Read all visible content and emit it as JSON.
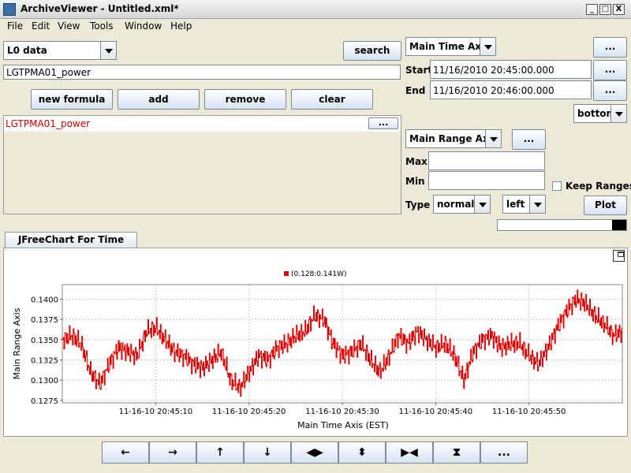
{
  "window": {
    "title": "ArchiveViewer - Untitled.xml*",
    "controls": [
      "_",
      "□",
      "X"
    ]
  },
  "menu": [
    "File",
    "Edit",
    "View",
    "Tools",
    "Window",
    "Help"
  ],
  "left": {
    "source_combo": "L0 data",
    "search_label": "search",
    "pv_input": "LGTPMA01_power",
    "buttons": {
      "new_formula": "new formula",
      "add": "add",
      "remove": "remove",
      "clear": "clear"
    },
    "list_item": "LGTPMA01_power",
    "list_item_button": "...",
    "list_item_color": "#cc0000"
  },
  "right": {
    "time_axis_combo": "Main Time Axis",
    "time_axis_button": "...",
    "start_label": "Start",
    "start_value": "11/16/2010 20:45:00.000",
    "end_label": "End",
    "end_value": "11/16/2010 20:46:00.000",
    "start_button": "...",
    "end_button": "...",
    "position_combo": "bottom",
    "range_axis_combo": "Main Range Axis",
    "range_axis_button": "...",
    "max_label": "Max",
    "max_value": "",
    "min_label": "Min",
    "min_value": "",
    "keep_ranges_label": "Keep Ranges",
    "type_label": "Type",
    "type_combo": "normal",
    "side_combo": "left",
    "plot_button": "Plot"
  },
  "tab_label": "JFreeChart For Time Plots",
  "nav_buttons": [
    "←",
    "→",
    "↑",
    "↓",
    "◀▶",
    "⬍",
    "▶◀",
    "⧗",
    "..."
  ],
  "chart_data": {
    "type": "line",
    "legend": "(0.128:0.141W)",
    "legend_placement": "top-center",
    "xlabel": "Main Time Axis (EST)",
    "ylabel": "Main Range Axis",
    "x_ticks": [
      "11-16-10 20:45:10",
      "11-16-10 20:45:20",
      "11-16-10 20:45:30",
      "11-16-10 20:45:40",
      "11-16-10 20:45:50"
    ],
    "x_tick_seconds": [
      10,
      20,
      30,
      40,
      50
    ],
    "xlim": [
      0,
      60
    ],
    "y_ticks": [
      "0.1275",
      "0.1300",
      "0.1325",
      "0.1350",
      "0.1375",
      "0.1400"
    ],
    "ylim": [
      0.1272,
      0.1418
    ],
    "grid": true,
    "series_color": "#dd0000",
    "x": [
      0,
      1,
      2,
      3,
      4,
      5,
      6,
      7,
      8,
      9,
      10,
      11,
      12,
      13,
      14,
      15,
      16,
      17,
      18,
      19,
      20,
      21,
      22,
      23,
      24,
      25,
      26,
      27,
      28,
      29,
      30,
      31,
      32,
      33,
      34,
      35,
      36,
      37,
      38,
      39,
      40,
      41,
      42,
      43,
      44,
      45,
      46,
      47,
      48,
      49,
      50,
      51,
      52,
      53,
      54,
      55,
      56,
      57,
      58,
      59,
      60
    ],
    "values": [
      0.135,
      0.1355,
      0.1345,
      0.131,
      0.1295,
      0.132,
      0.134,
      0.1335,
      0.133,
      0.136,
      0.1365,
      0.135,
      0.1335,
      0.133,
      0.132,
      0.1315,
      0.1325,
      0.1335,
      0.13,
      0.129,
      0.131,
      0.133,
      0.1325,
      0.134,
      0.1345,
      0.1355,
      0.136,
      0.138,
      0.1375,
      0.1345,
      0.133,
      0.1335,
      0.1345,
      0.1325,
      0.131,
      0.133,
      0.1355,
      0.1345,
      0.136,
      0.135,
      0.134,
      0.1345,
      0.133,
      0.13,
      0.1335,
      0.135,
      0.1355,
      0.134,
      0.1345,
      0.1345,
      0.133,
      0.132,
      0.134,
      0.1365,
      0.1385,
      0.14,
      0.1395,
      0.138,
      0.137,
      0.1355,
      0.136
    ]
  }
}
